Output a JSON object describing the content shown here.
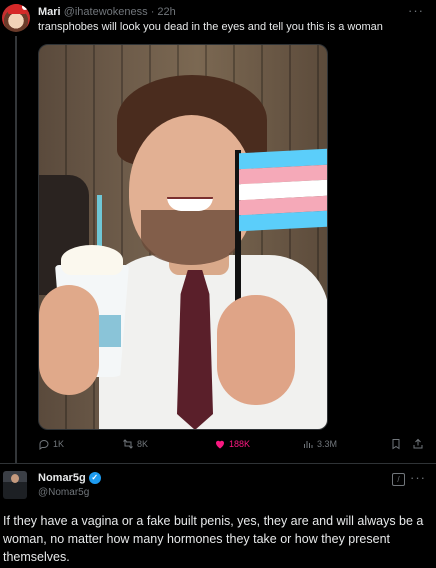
{
  "post": {
    "author_name": "Mari",
    "author_handle": "@ihatewokeness",
    "time": "22h",
    "text": "transphobes will look you dead in the eyes and tell you this is a woman",
    "more_label": "···",
    "image_description_icon": "photo",
    "actions": {
      "replies": "1K",
      "reposts": "8K",
      "likes": "188K",
      "views": "3.3M"
    },
    "flag_colors": [
      "#5bcefa",
      "#f5a9b8",
      "#ffffff",
      "#f5a9b8",
      "#5bcefa"
    ]
  },
  "reply": {
    "author_name": "Nomar5g",
    "author_handle": "@Nomar5g",
    "more_label": "···",
    "text": "If they have a vagina or a fake built penis, yes, they are and will always be a woman, no matter how many hormones they take or how they present themselves."
  },
  "colors": {
    "background": "#000000",
    "text": "#e7e9ea",
    "muted": "#71767b",
    "like": "#f91880",
    "verified": "#1d9bf0"
  }
}
